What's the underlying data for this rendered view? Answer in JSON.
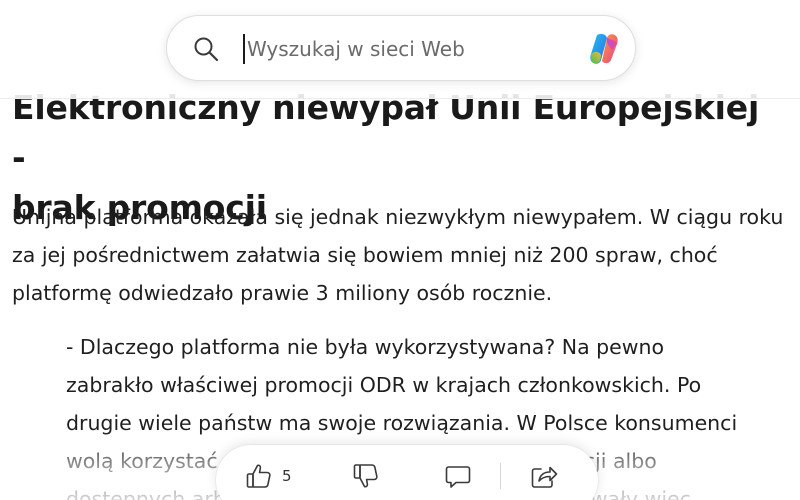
{
  "search": {
    "placeholder": "Wyszukaj w sieci Web",
    "value": ""
  },
  "article": {
    "headline_lines": [
      "Elektroniczny niewypał Unii Europejskiej -",
      "brak promocji"
    ],
    "paragraph_1_lines": [
      "Unijna platforma okazała się jednak niezwykłym niewypałem. W ciągu roku",
      "za jej pośrednictwem załatwia się bowiem mniej niż 200 spraw, choć",
      "platformę odwiedzało prawie 3 miliony osób rocznie."
    ],
    "paragraph_2_lines": [
      "- Dlaczego platforma nie była wykorzystywana? Na pewno",
      "zabrakło właściwej promocji ODR w krajach członkowskich. Po",
      "drugie wiele państw ma swoje rozwiązania. W Polsce konsumenci",
      "wolą korzystać z rozwiązań krajowych, czyli mediacji albo",
      "dostępnych arbitraży konsumenckich, które też stawały więc"
    ]
  },
  "actions": {
    "like_count": "5"
  },
  "icons": {
    "search": "search-icon",
    "copilot": "copilot-icon",
    "like": "thumbs-up-icon",
    "dislike": "thumbs-down-icon",
    "comment": "comment-icon",
    "share": "share-icon"
  },
  "colors": {
    "text": "#1a1a1a",
    "icon": "#3a3a3a",
    "background": "#ffffff"
  }
}
